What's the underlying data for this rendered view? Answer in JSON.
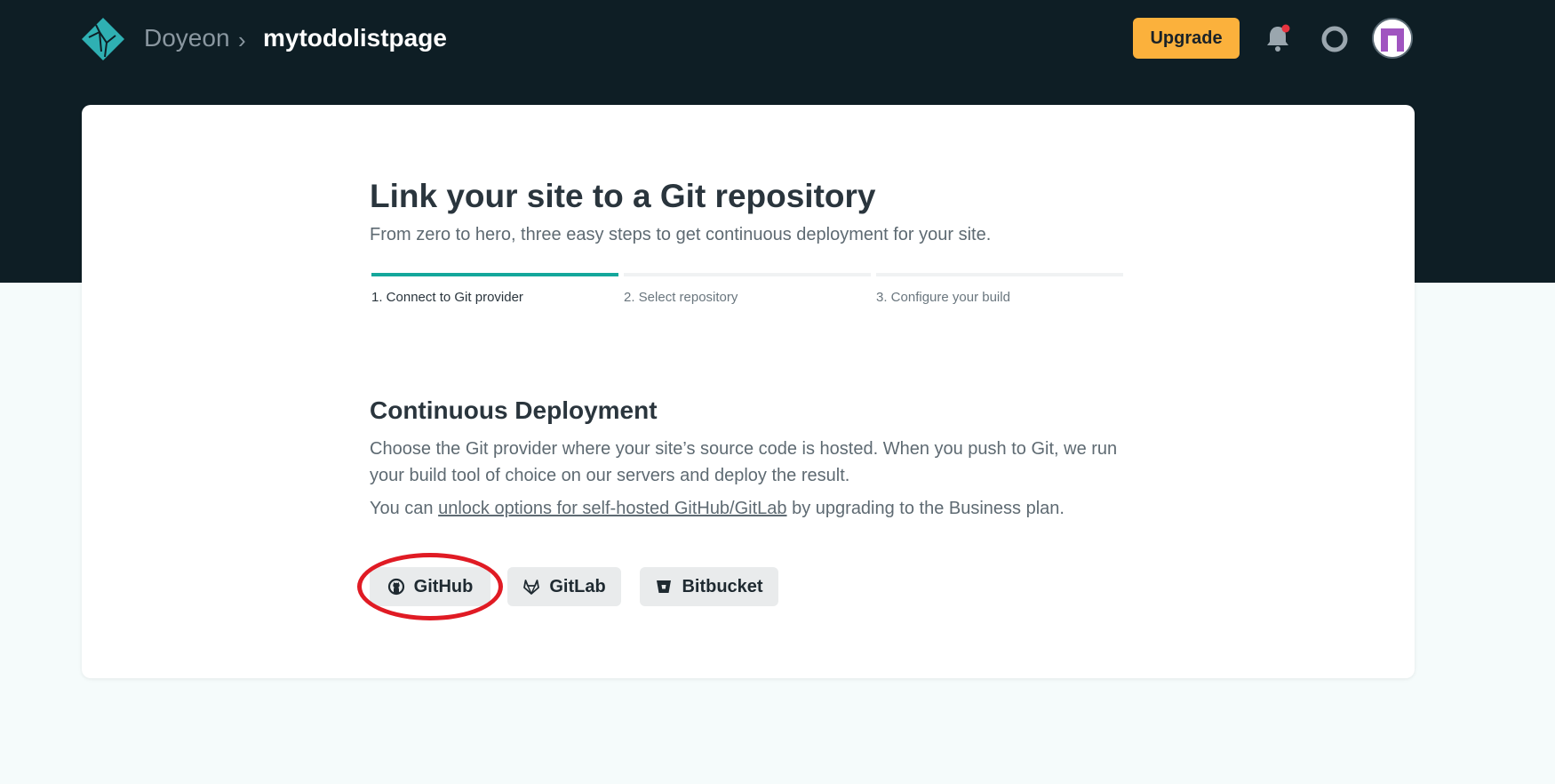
{
  "topbar": {
    "owner": "Doyeon",
    "separator": "›",
    "site_name": "mytodolistpage",
    "upgrade_label": "Upgrade"
  },
  "main": {
    "title": "Link your site to a Git repository",
    "subtitle": "From zero to hero, three easy steps to get continuous deployment for your site.",
    "steps": [
      {
        "label": "1. Connect to Git provider",
        "active": true
      },
      {
        "label": "2. Select repository",
        "active": false
      },
      {
        "label": "3. Configure your build",
        "active": false
      }
    ],
    "cd_title": "Continuous Deployment",
    "cd_description": "Choose the Git provider where your site’s source code is hosted. When you push to Git, we run your build tool of choice on our servers and deploy the result.",
    "cd_note_prefix": "You can ",
    "cd_note_link": "unlock options for self-hosted GitHub/GitLab",
    "cd_note_suffix": " by upgrading to the Business plan.",
    "providers": [
      {
        "label": "GitHub",
        "icon": "github-icon"
      },
      {
        "label": "GitLab",
        "icon": "gitlab-icon"
      },
      {
        "label": "Bitbucket",
        "icon": "bitbucket-icon"
      }
    ]
  },
  "colors": {
    "header_bg": "#0e1e25",
    "accent": "#14a79b",
    "upgrade": "#fbb13c",
    "highlight": "#e01b24"
  }
}
